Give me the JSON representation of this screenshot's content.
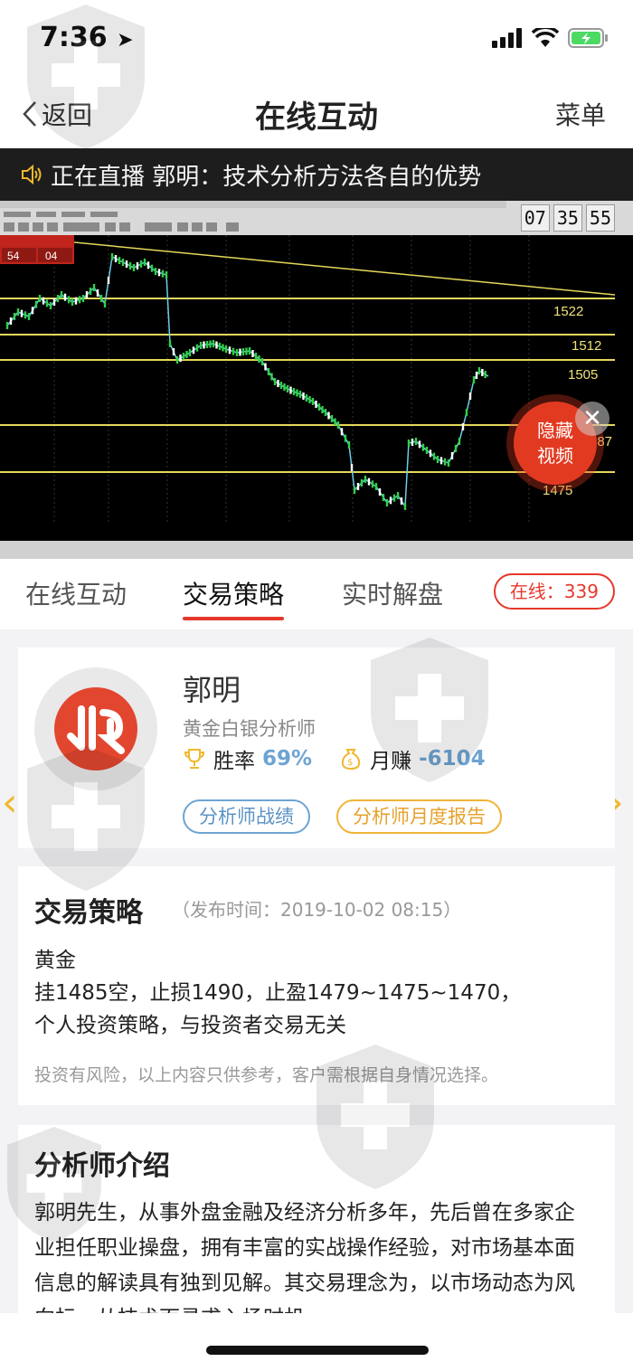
{
  "status_bar": {
    "time": "7:36"
  },
  "nav": {
    "back_label": "返回",
    "title": "在线互动",
    "menu_label": "菜单"
  },
  "live_banner": {
    "text": "正在直播 郭明：技术分析方法各自的优势"
  },
  "video": {
    "clock": [
      "07",
      "35",
      "55"
    ],
    "price_levels": [
      "1522",
      "1512",
      "1505",
      "487",
      "1475"
    ],
    "hide_button": {
      "line1": "隐藏",
      "line2": "视频"
    }
  },
  "tabs": [
    {
      "label": "在线互动"
    },
    {
      "label": "交易策略"
    },
    {
      "label": "实时解盘"
    }
  ],
  "online_badge": "在线：339",
  "analyst": {
    "name": "郭明",
    "title": "黄金白银分析师",
    "win_rate_label": "胜率",
    "win_rate_value": "69%",
    "monthly_label": "月赚",
    "monthly_value": "-6104",
    "record_button": "分析师战绩",
    "report_button": "分析师月度报告"
  },
  "strategy": {
    "title": "交易策略",
    "published": "（发布时间：2019-10-02 08:15）",
    "body": "黄金\n挂1485空，止损1490，止盈1479~1475~1470，\n个人投资策略，与投资者交易无关",
    "disclaimer": "投资有风险，以上内容只供参考，客户需根据自身情况选择。"
  },
  "intro": {
    "title": "分析师介绍",
    "body": "郭明先生，从事外盘金融及经济分析多年，先后曾在多家企业担任职业操盘，拥有丰富的实战操作经验，对市场基本面信息的解读具有独到见解。其交易理念为，以市场动态为风向标，从技术面寻求入场时机"
  },
  "colors": {
    "accent_red": "#e5392c",
    "accent_blue": "#6ea4d2",
    "accent_gold": "#f1b43a",
    "banner_bg": "#1d1d1d"
  }
}
